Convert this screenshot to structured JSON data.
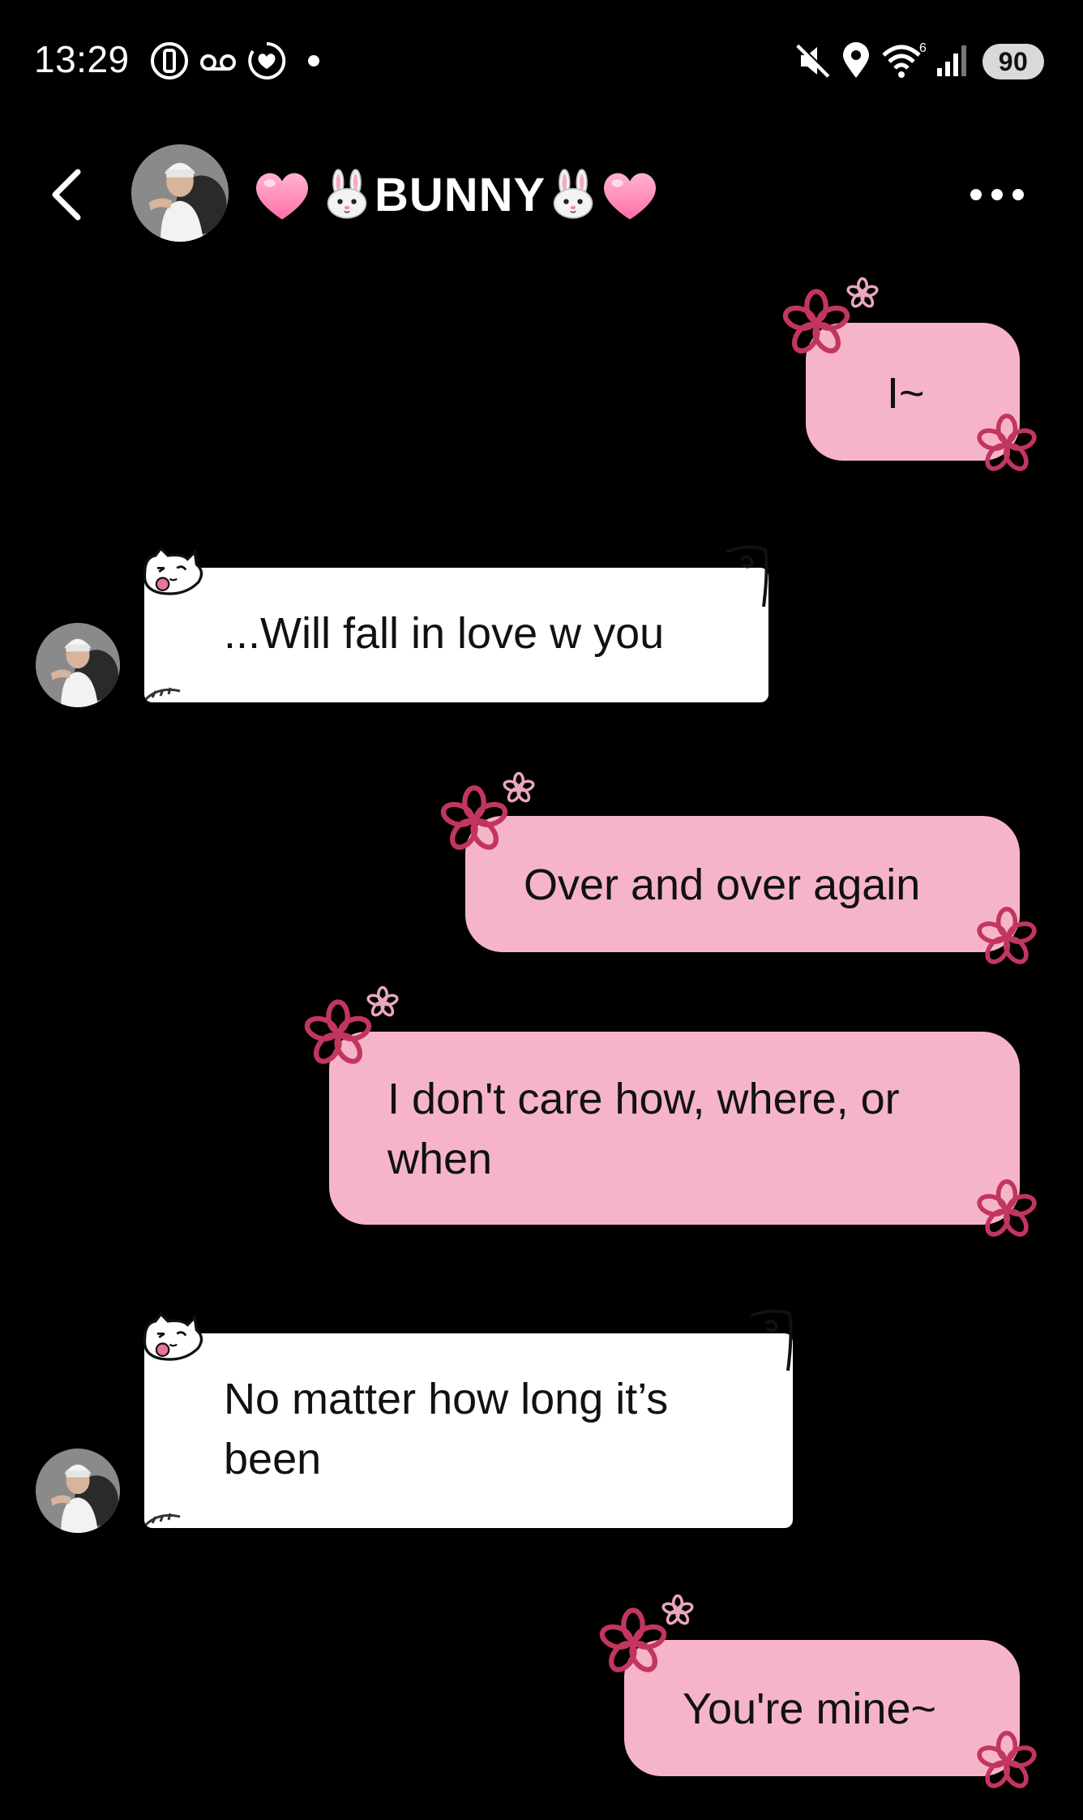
{
  "status_bar": {
    "time": "13:29",
    "wifi_label": "6",
    "battery": "90",
    "icons": [
      "phone-vibrate-icon",
      "voicemail-icon",
      "heart-circle-icon",
      "mute-icon",
      "location-icon",
      "wifi-icon",
      "signal-icon"
    ]
  },
  "header": {
    "back_icon": "chevron-left-icon",
    "title": "BUNNY",
    "more_icon": "ellipsis-icon"
  },
  "messages": [
    {
      "direction": "outgoing",
      "text": "I~"
    },
    {
      "direction": "incoming",
      "text": "...Will fall in love w you"
    },
    {
      "direction": "outgoing",
      "text": "Over and over again"
    },
    {
      "direction": "outgoing",
      "text": "I don't care how, where, or when"
    },
    {
      "direction": "incoming",
      "text": "No matter how long it’s been"
    },
    {
      "direction": "outgoing",
      "text": "You're mine~"
    }
  ],
  "colors": {
    "background": "#000000",
    "outgoing_bubble": "#f6b4cb",
    "incoming_bubble": "#ffffff",
    "flower_accent": "#c2365e"
  }
}
